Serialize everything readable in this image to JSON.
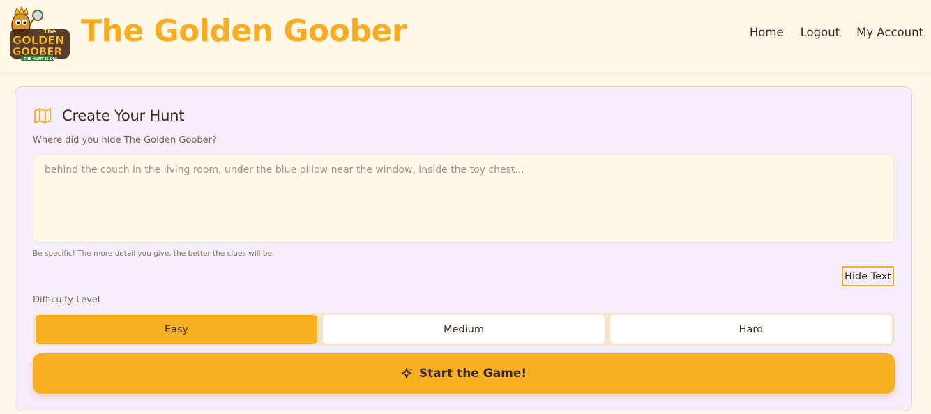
{
  "header": {
    "logo": {
      "line1": "The",
      "line2": "GOLDEN",
      "line3": "GOOBER",
      "tagline": "THE HUNT IS ON!"
    },
    "title": "The Golden Goober",
    "nav": [
      {
        "label": "Home"
      },
      {
        "label": "Logout"
      },
      {
        "label": "My Account"
      }
    ]
  },
  "card": {
    "title": "Create Your Hunt",
    "title_icon": "map-icon",
    "location_label": "Where did you hide The Golden Goober?",
    "location_placeholder": "behind the couch in the living room, under the blue pillow near the window, inside the toy chest...",
    "location_value": "",
    "hint": "Be specific! The more detail you give, the better the clues will be.",
    "hide_text_button": "Hide Text",
    "difficulty_label": "Difficulty Level",
    "difficulty_options": [
      {
        "label": "Easy",
        "selected": true
      },
      {
        "label": "Medium",
        "selected": false
      },
      {
        "label": "Hard",
        "selected": false
      }
    ],
    "start_button": "Start the Game!",
    "start_icon": "sparkle-icon"
  },
  "colors": {
    "brand": "#f7ac22",
    "page_background": "#fef8ea",
    "card_background": "#f7eefb",
    "selected_difficulty": "#f8b021"
  }
}
